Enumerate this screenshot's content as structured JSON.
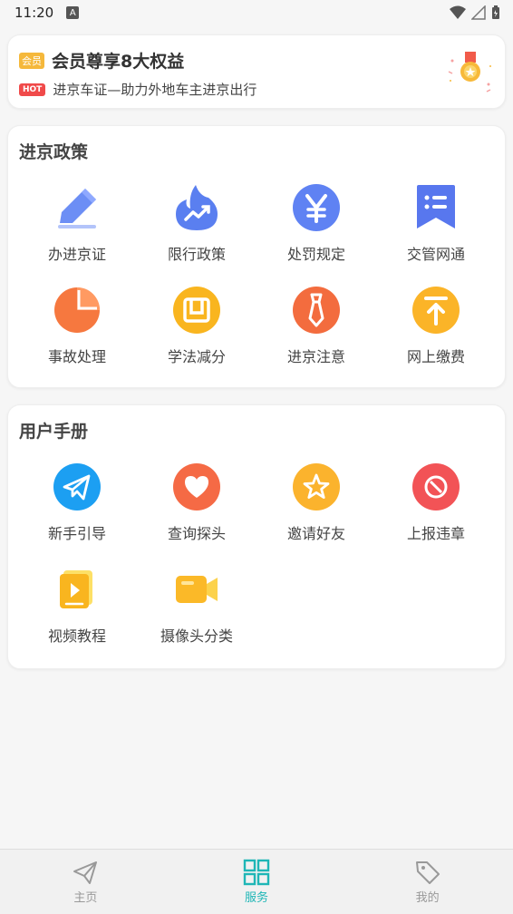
{
  "status_bar": {
    "time": "11:20",
    "notification_letter": "A"
  },
  "member": {
    "tag": "会员",
    "title": "会员尊享8大权益",
    "hot_tag": "HOT",
    "subtitle": "进京车证—助力外地车主进京出行"
  },
  "policy": {
    "title": "进京政策",
    "items": [
      {
        "label": "办进京证",
        "icon": "pencil-icon"
      },
      {
        "label": "限行政策",
        "icon": "flame-chart-icon"
      },
      {
        "label": "处罚规定",
        "icon": "yen-icon"
      },
      {
        "label": "交管网通",
        "icon": "bookmark-list-icon"
      },
      {
        "label": "事故处理",
        "icon": "pie-icon"
      },
      {
        "label": "学法减分",
        "icon": "book-icon"
      },
      {
        "label": "进京注意",
        "icon": "tie-icon"
      },
      {
        "label": "网上缴费",
        "icon": "upload-icon"
      }
    ]
  },
  "manual": {
    "title": "用户手册",
    "items": [
      {
        "label": "新手引导",
        "icon": "paper-plane-icon"
      },
      {
        "label": "查询探头",
        "icon": "heart-icon"
      },
      {
        "label": "邀请好友",
        "icon": "star-icon"
      },
      {
        "label": "上报违章",
        "icon": "prohibit-icon"
      },
      {
        "label": "视频教程",
        "icon": "video-play-icon"
      },
      {
        "label": "摄像头分类",
        "icon": "camera-icon"
      }
    ]
  },
  "tabbar": {
    "tabs": [
      {
        "label": "主页",
        "icon": "send-icon",
        "active": false
      },
      {
        "label": "服务",
        "icon": "grid-icon",
        "active": true
      },
      {
        "label": "我的",
        "icon": "tag-icon",
        "active": false
      }
    ]
  },
  "colors": {
    "accent": "#1fb6b6",
    "gold": "#f5b83b",
    "hot": "#f04a4a"
  }
}
